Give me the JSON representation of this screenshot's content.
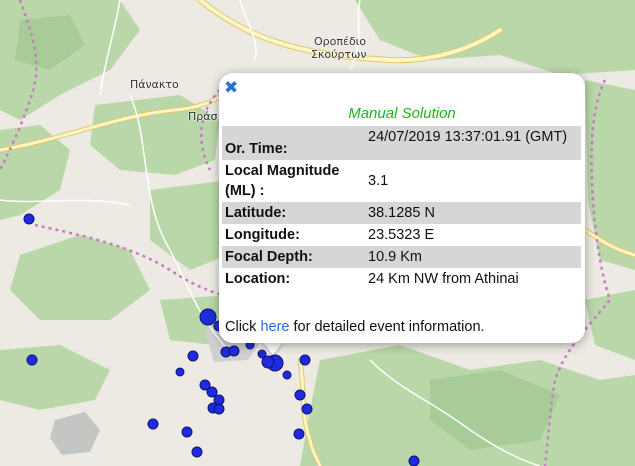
{
  "map": {
    "place_labels": [
      {
        "id": "panakto",
        "text": "Πάνακτο"
      },
      {
        "id": "oropedio",
        "text": "Οροπέδιο"
      },
      {
        "id": "skourton",
        "text": "Σκούρτων"
      },
      {
        "id": "pras",
        "text": "Πράσ"
      }
    ],
    "colors": {
      "land": "#eceae2",
      "forest": "#b9d7a8",
      "road": "#fbf6c7",
      "road_edge": "#e2c86a",
      "border": "#c57cc3",
      "marker": "#1f2bdc",
      "marker_edge": "#0b127a"
    },
    "marker_count": 27
  },
  "popup": {
    "close_icon": "close-x-icon",
    "title": "Manual Solution",
    "rows": [
      {
        "label": "Or. Time:",
        "value": "24/07/2019 13:37:01.91 (GMT)"
      },
      {
        "label": "Local Magnitude (ML) :",
        "value": "3.1"
      },
      {
        "label": "Latitude:",
        "value": "38.1285 N"
      },
      {
        "label": "Longitude:",
        "value": "23.5323 E"
      },
      {
        "label": "Focal Depth:",
        "value": "10.9 Km"
      },
      {
        "label": "Location:",
        "value": "24 Km NW from Athinai"
      }
    ],
    "footer": {
      "pre": "Click ",
      "link": "here",
      "post": " for detailed event information."
    },
    "title_color": "#1fb51f",
    "link_color": "#2a6ad8"
  }
}
